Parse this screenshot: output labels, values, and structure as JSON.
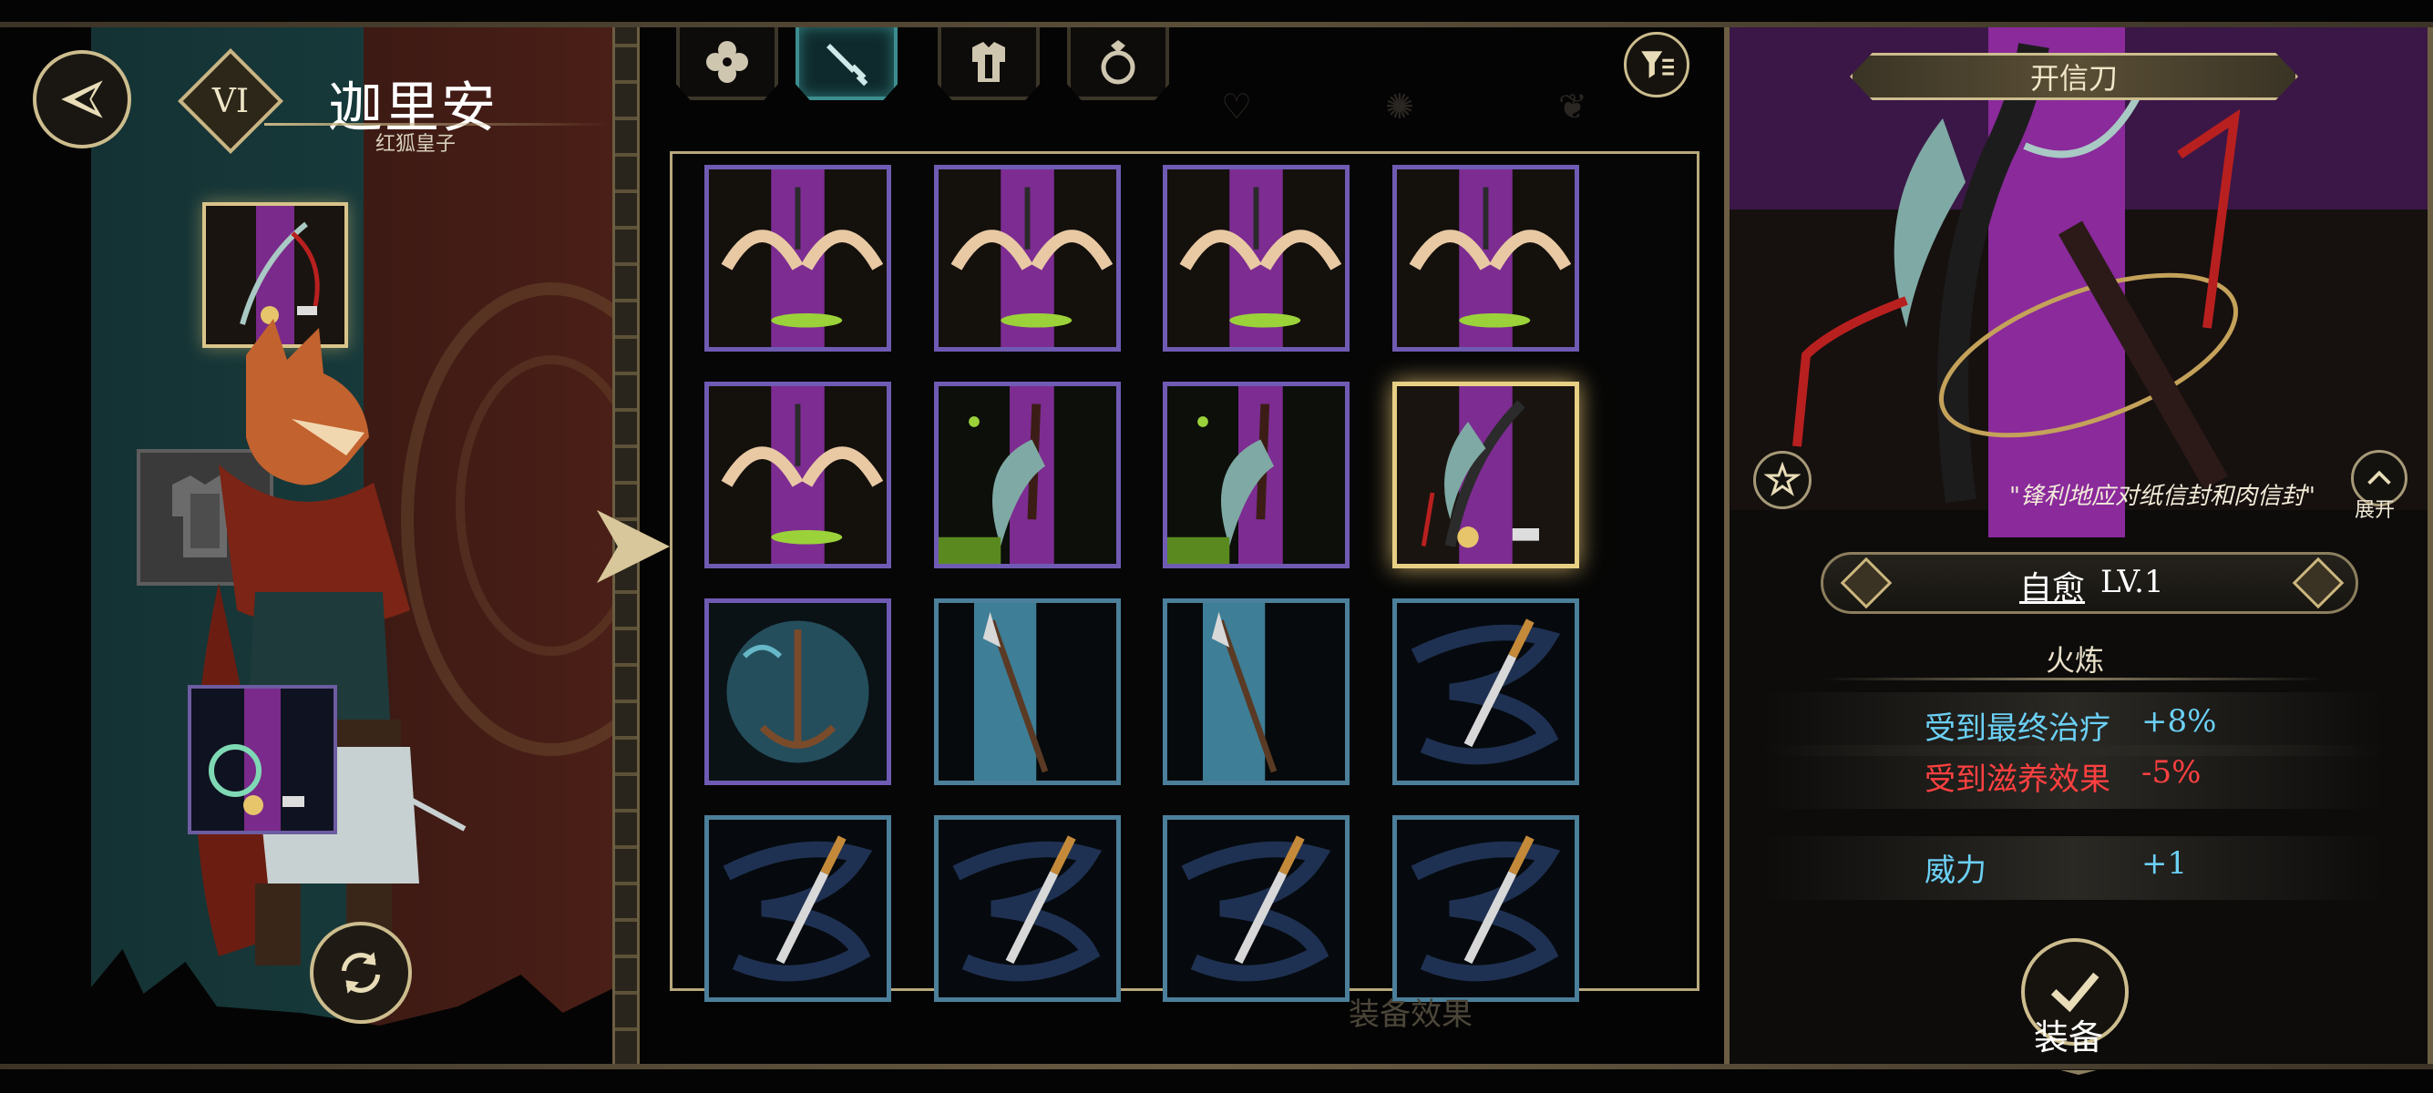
{
  "hero": {
    "rank": "VI",
    "name": "迦里安",
    "title": "红狐皇子"
  },
  "tabs": [
    {
      "id": "relics",
      "icon": "clover-icon"
    },
    {
      "id": "weapons",
      "icon": "dagger-icon",
      "active": true
    },
    {
      "id": "armor",
      "icon": "armor-icon"
    },
    {
      "id": "rings",
      "icon": "ring-icon"
    }
  ],
  "grid": {
    "rows": 4,
    "cols": 4,
    "selected_index": 7,
    "cells": [
      {
        "art": "purple-hooks",
        "rarity": "purple"
      },
      {
        "art": "purple-hooks",
        "rarity": "purple"
      },
      {
        "art": "purple-hooks",
        "rarity": "purple"
      },
      {
        "art": "purple-hooks",
        "rarity": "purple"
      },
      {
        "art": "purple-hooks",
        "rarity": "purple"
      },
      {
        "art": "purple-scythe",
        "rarity": "purple"
      },
      {
        "art": "purple-scythe",
        "rarity": "purple"
      },
      {
        "art": "letter-opener",
        "rarity": "purple"
      },
      {
        "art": "blue-anchor",
        "rarity": "purple"
      },
      {
        "art": "blue-spear",
        "rarity": "blue"
      },
      {
        "art": "blue-spear",
        "rarity": "blue"
      },
      {
        "art": "blue-knife",
        "rarity": "blue"
      },
      {
        "art": "blue-knife",
        "rarity": "blue"
      },
      {
        "art": "blue-knife",
        "rarity": "blue"
      },
      {
        "art": "blue-knife",
        "rarity": "blue"
      },
      {
        "art": "blue-knife",
        "rarity": "blue"
      }
    ]
  },
  "equip_effect_label": "装备效果",
  "detail": {
    "item_name": "开信刀",
    "flavor_text": "\"锋利地应对纸信封和肉信封\"",
    "expand_label": "展开",
    "skill_name": "自愈",
    "skill_level": "LV.1",
    "section_title": "火炼",
    "stats": [
      {
        "label": "受到最终治疗",
        "value": "+8%",
        "color": "#6bd0f5"
      },
      {
        "label": "受到滋养效果",
        "value": "-5%",
        "color": "#ff4040"
      }
    ],
    "power_label": "威力",
    "power_value": "+1",
    "equip_button_label": "装备"
  },
  "colors": {
    "gold": "#cdbd8e",
    "purple_rarity": "#6f5bb3",
    "blue_rarity": "#4b7f9a",
    "selected_glow": "#e7cf84"
  }
}
